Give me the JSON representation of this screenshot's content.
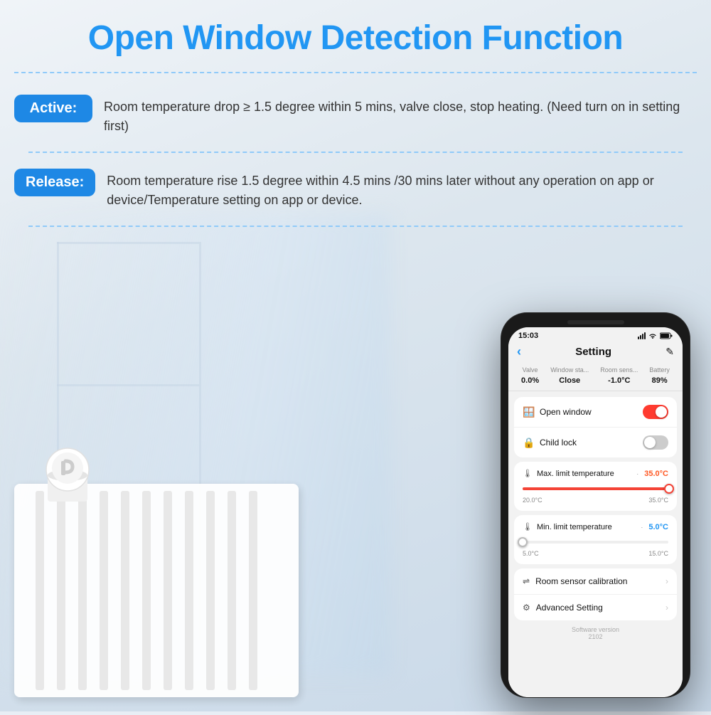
{
  "page": {
    "title": "Open Window Detection Function",
    "title_color": "#2196f3"
  },
  "active": {
    "badge": "Active:",
    "description": "Room temperature drop ≥ 1.5 degree within 5 mins, valve close, stop heating. (Need turn on in setting first)"
  },
  "release": {
    "badge": "Release:",
    "description": "Room temperature rise 1.5 degree within 4.5 mins /30 mins later without any operation on app or device/Temperature setting on app or device."
  },
  "phone": {
    "time": "15:03",
    "header_title": "Setting",
    "back_label": "‹",
    "edit_icon": "✎",
    "status": {
      "valve_label": "Valve",
      "valve_value": "0.0%",
      "window_label": "Window sta...",
      "window_value": "Close",
      "room_label": "Room sens...",
      "room_value": "-1.0°C",
      "battery_label": "Battery",
      "battery_value": "89%"
    },
    "settings": {
      "open_window_label": "Open window",
      "open_window_on": true,
      "child_lock_label": "Child lock",
      "child_lock_on": false
    },
    "max_temp": {
      "label": "Max. limit temperature",
      "value": "35.0°C",
      "min": "20.0°C",
      "max": "35.0°C",
      "fill_percent": 100
    },
    "min_temp": {
      "label": "Min. limit temperature",
      "value": "5.0°C",
      "min": "5.0°C",
      "max": "15.0°C",
      "fill_percent": 0
    },
    "nav_items": [
      {
        "icon": "⇌",
        "label": "Room sensor calibration"
      },
      {
        "icon": "⚙",
        "label": "Advanced Setting"
      }
    ],
    "software": {
      "label": "Software version",
      "version": "2102"
    }
  }
}
